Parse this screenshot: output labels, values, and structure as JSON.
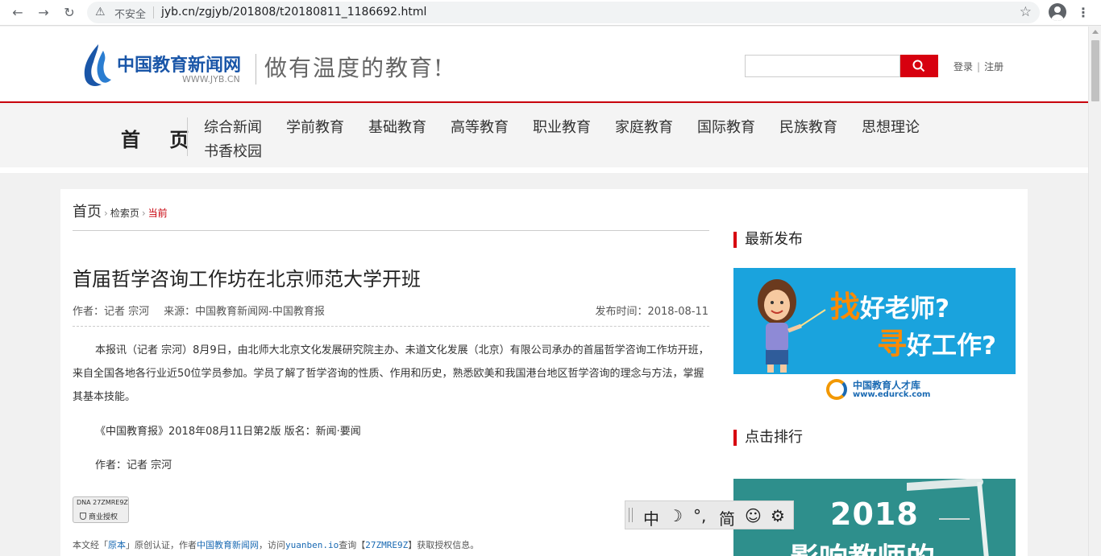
{
  "browser": {
    "security_label": "不安全",
    "url": "jyb.cn/zgjyb/201808/t20180811_1186692.html"
  },
  "header": {
    "logo_name": "中国教育新闻网",
    "logo_url": "WWW.JYB.CN",
    "slogan": "做有温度的教育!",
    "login_label": "登录",
    "register_label": "注册",
    "search_placeholder": ""
  },
  "nav": {
    "home": "首 页",
    "items": [
      "综合新闻",
      "学前教育",
      "基础教育",
      "高等教育",
      "职业教育",
      "家庭教育",
      "国际教育",
      "民族教育",
      "思想理论",
      "书香校园"
    ]
  },
  "breadcrumb": {
    "home": "首页",
    "search": "检索页",
    "current": "当前"
  },
  "article": {
    "title": "首届哲学咨询工作坊在北京师范大学开班",
    "author_label": "作者：记者 宗河",
    "source_label": "来源：中国教育新闻网-中国教育报",
    "date_label": "发布时间：2018-08-11",
    "body": "本报讯（记者 宗河）8月9日，由北师大北京文化发展研究院主办、未道文化发展（北京）有限公司承办的首届哲学咨询工作坊开班，来自全国各地各行业近50位学员参加。学员了解了哲学咨询的性质、作用和历史，熟悉欧美和我国港台地区哲学咨询的理念与方法，掌握其基本技能。",
    "edition": "《中国教育报》2018年08月11日第2版 版名：新闻·要闻",
    "author_line": "作者：记者 宗河"
  },
  "dna": {
    "code": "DNA 27ZMRE9Z",
    "label": "商业授权"
  },
  "copyright": {
    "prefix": "本文经「",
    "brand": "原本",
    "mid1": "」原创认证，作者",
    "author": "中国教育新闻网",
    "mid2": "，访问",
    "site": "yuanben.io",
    "mid3": "查询【",
    "code": "27ZMRE9Z",
    "suffix": "】获取授权信息。"
  },
  "sidebar": {
    "latest_heading": "最新发布",
    "ranking_heading": "点击排行",
    "ad": {
      "find_char": "找",
      "find_rest": "好老师?",
      "seek_char": "寻",
      "seek_rest": "好工作?",
      "brand": "中国教育人才库",
      "site": "www.edurck.com"
    },
    "teacher_banner": {
      "year": "2018",
      "subtitle": "影响教师的"
    }
  },
  "ime": {
    "lang": "中",
    "moon": "☽",
    "punct": "°,",
    "script": "简",
    "emoji": "☺",
    "settings": "⚙"
  },
  "colors": {
    "brand_red": "#d7000f",
    "brand_blue": "#1a56a8",
    "ad_blue": "#1aa3dd",
    "ad_orange": "#ff8a00"
  }
}
